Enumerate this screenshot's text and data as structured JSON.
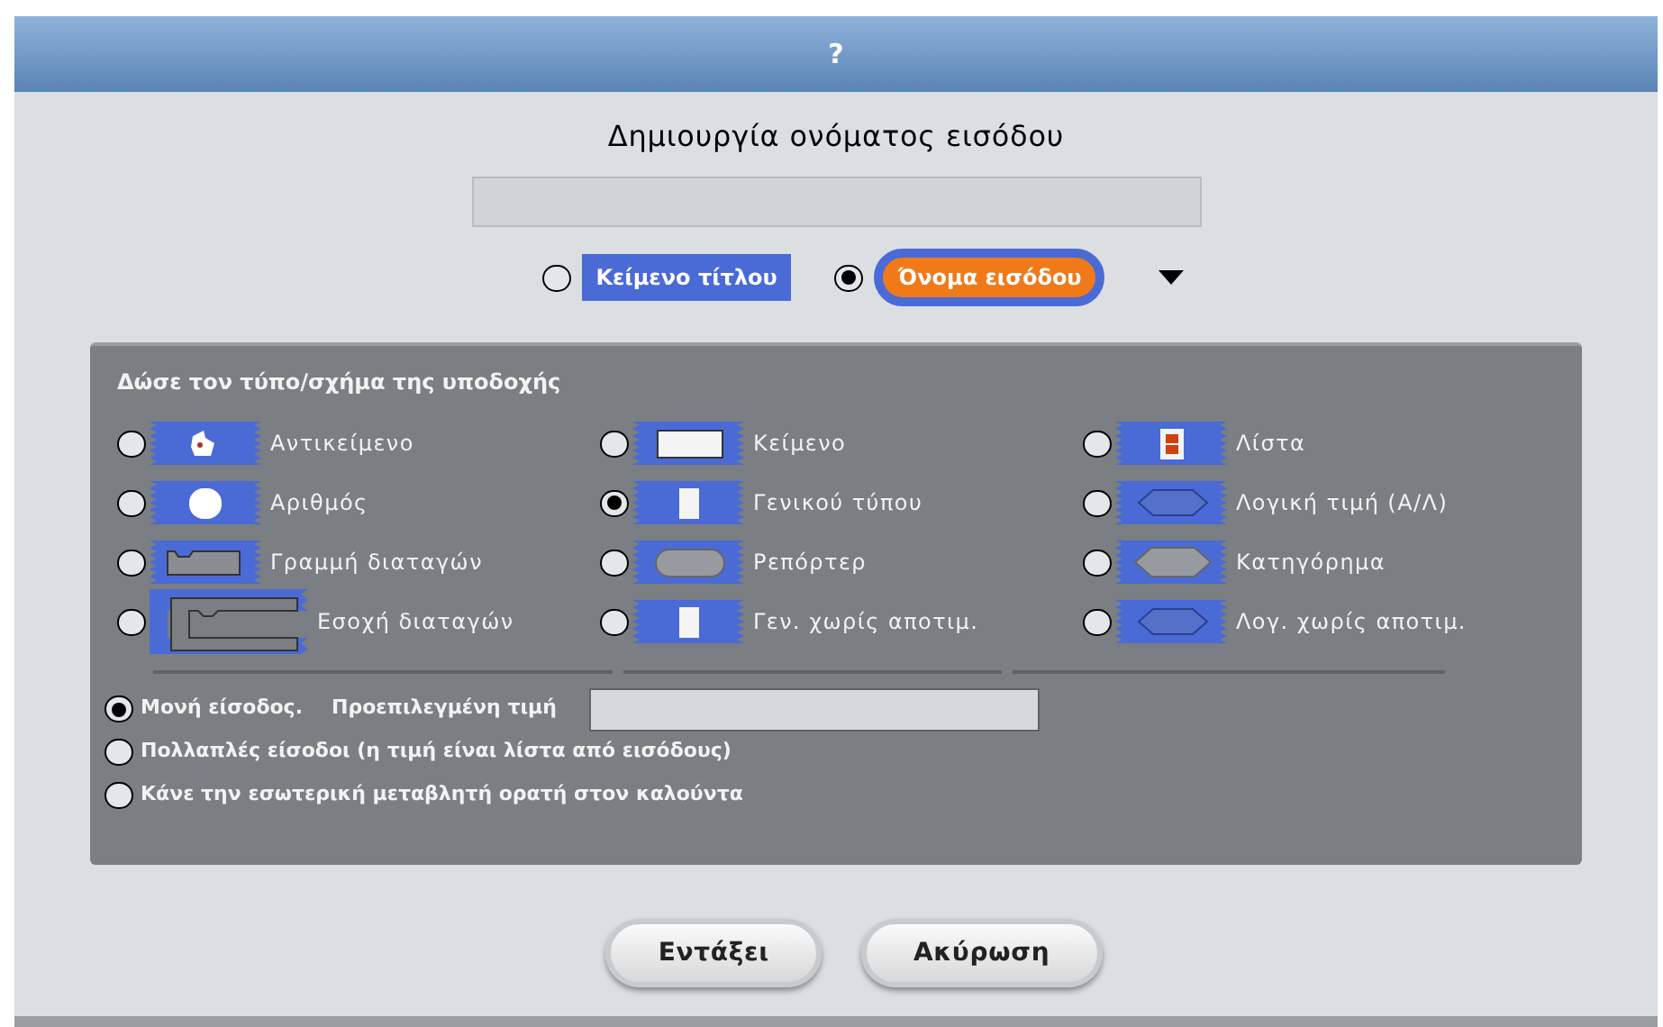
{
  "window": {
    "title": "?"
  },
  "heading": "Δημιουργία ονόματος εισόδου",
  "label_options": [
    {
      "label": "Κείμενο τίτλου",
      "kind": "title",
      "selected": false
    },
    {
      "label": "Όνομα εισόδου",
      "kind": "input-name",
      "selected": true
    }
  ],
  "slot_panel": {
    "title": "Δώσε τον τύπο/σχήμα της υποδοχής",
    "slot_types": [
      {
        "label": "Αντικείμενο",
        "kind": "object",
        "selected": false
      },
      {
        "label": "Κείμενο",
        "kind": "text",
        "selected": false
      },
      {
        "label": "Λίστα",
        "kind": "list",
        "selected": false
      },
      {
        "label": "Αριθμός",
        "kind": "number",
        "selected": false
      },
      {
        "label": "Γενικού τύπου",
        "kind": "any",
        "selected": true
      },
      {
        "label": "Λογική τιμή (Α/Λ)",
        "kind": "boolean",
        "selected": false
      },
      {
        "label": "Γραμμή διαταγών",
        "kind": "command",
        "selected": false
      },
      {
        "label": "Ρεπόρτερ",
        "kind": "reporter",
        "selected": false
      },
      {
        "label": "Κατηγόρημα",
        "kind": "predicate",
        "selected": false
      },
      {
        "label": "Εσοχή διαταγών",
        "kind": "c-slot",
        "selected": false
      },
      {
        "label": "Γεν. χωρίς αποτιμ.",
        "kind": "any",
        "selected": false
      },
      {
        "label": "Λογ. χωρίς αποτιμ.",
        "kind": "boolean",
        "selected": false
      }
    ],
    "input_modes": [
      {
        "label": "Μονή είσοδος.",
        "default_label": "Προεπιλεγμένη τιμή",
        "selected": true
      },
      {
        "label": "Πολλαπλές είσοδοι (η τιμή είναι λίστα από εισόδους)",
        "selected": false
      },
      {
        "label": "Κάνε την εσωτερική μεταβλητή ορατή στον καλούντα",
        "selected": false
      }
    ]
  },
  "buttons": [
    {
      "label": "Εντάξει"
    },
    {
      "label": "Ακύρωση"
    }
  ]
}
